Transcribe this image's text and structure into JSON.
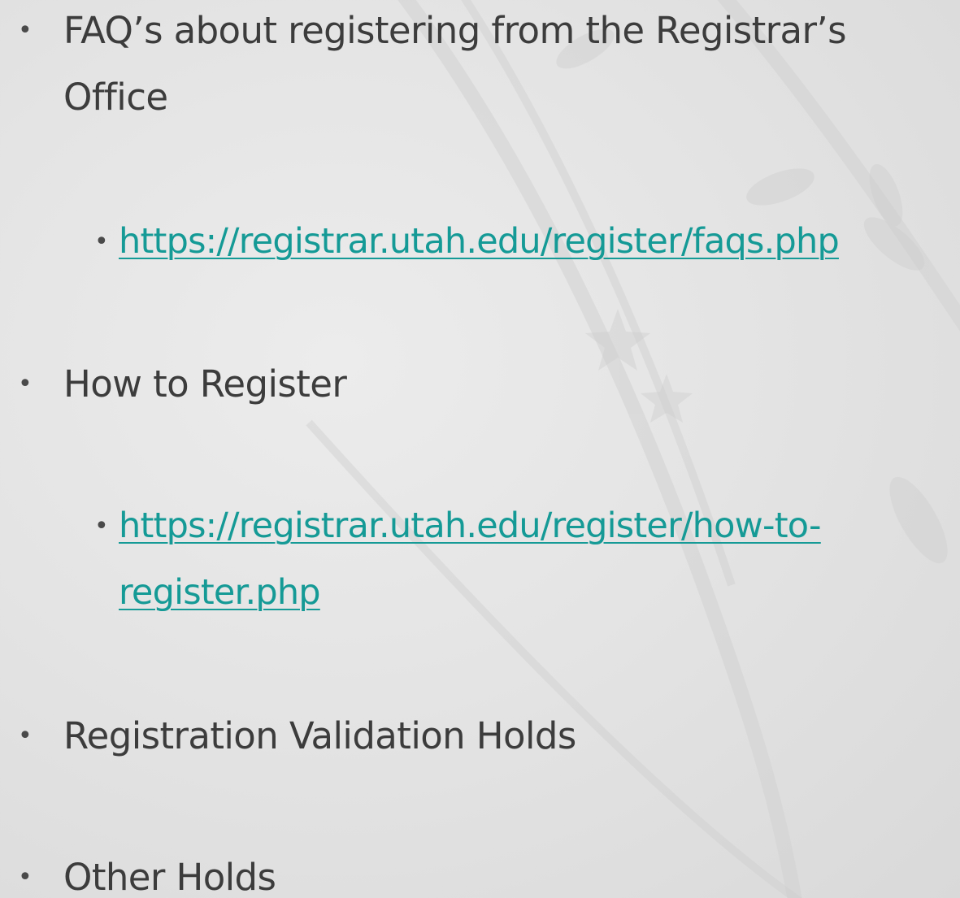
{
  "slide": {
    "items": [
      {
        "text_line1": "FAQ’s about registering from the Registrar’s",
        "text_line2": "Office"
      },
      {
        "link_text": "https://registrar.utah.edu/register/faqs.php"
      },
      {
        "text": "How to Register"
      },
      {
        "link_line1": "https://registrar.utah.edu/register/how-to-",
        "link_line2": "register.php"
      },
      {
        "text": "Registration Validation Holds"
      },
      {
        "text": "Other Holds"
      }
    ],
    "bullet_glyph": "•",
    "link_color": "#159a96"
  }
}
